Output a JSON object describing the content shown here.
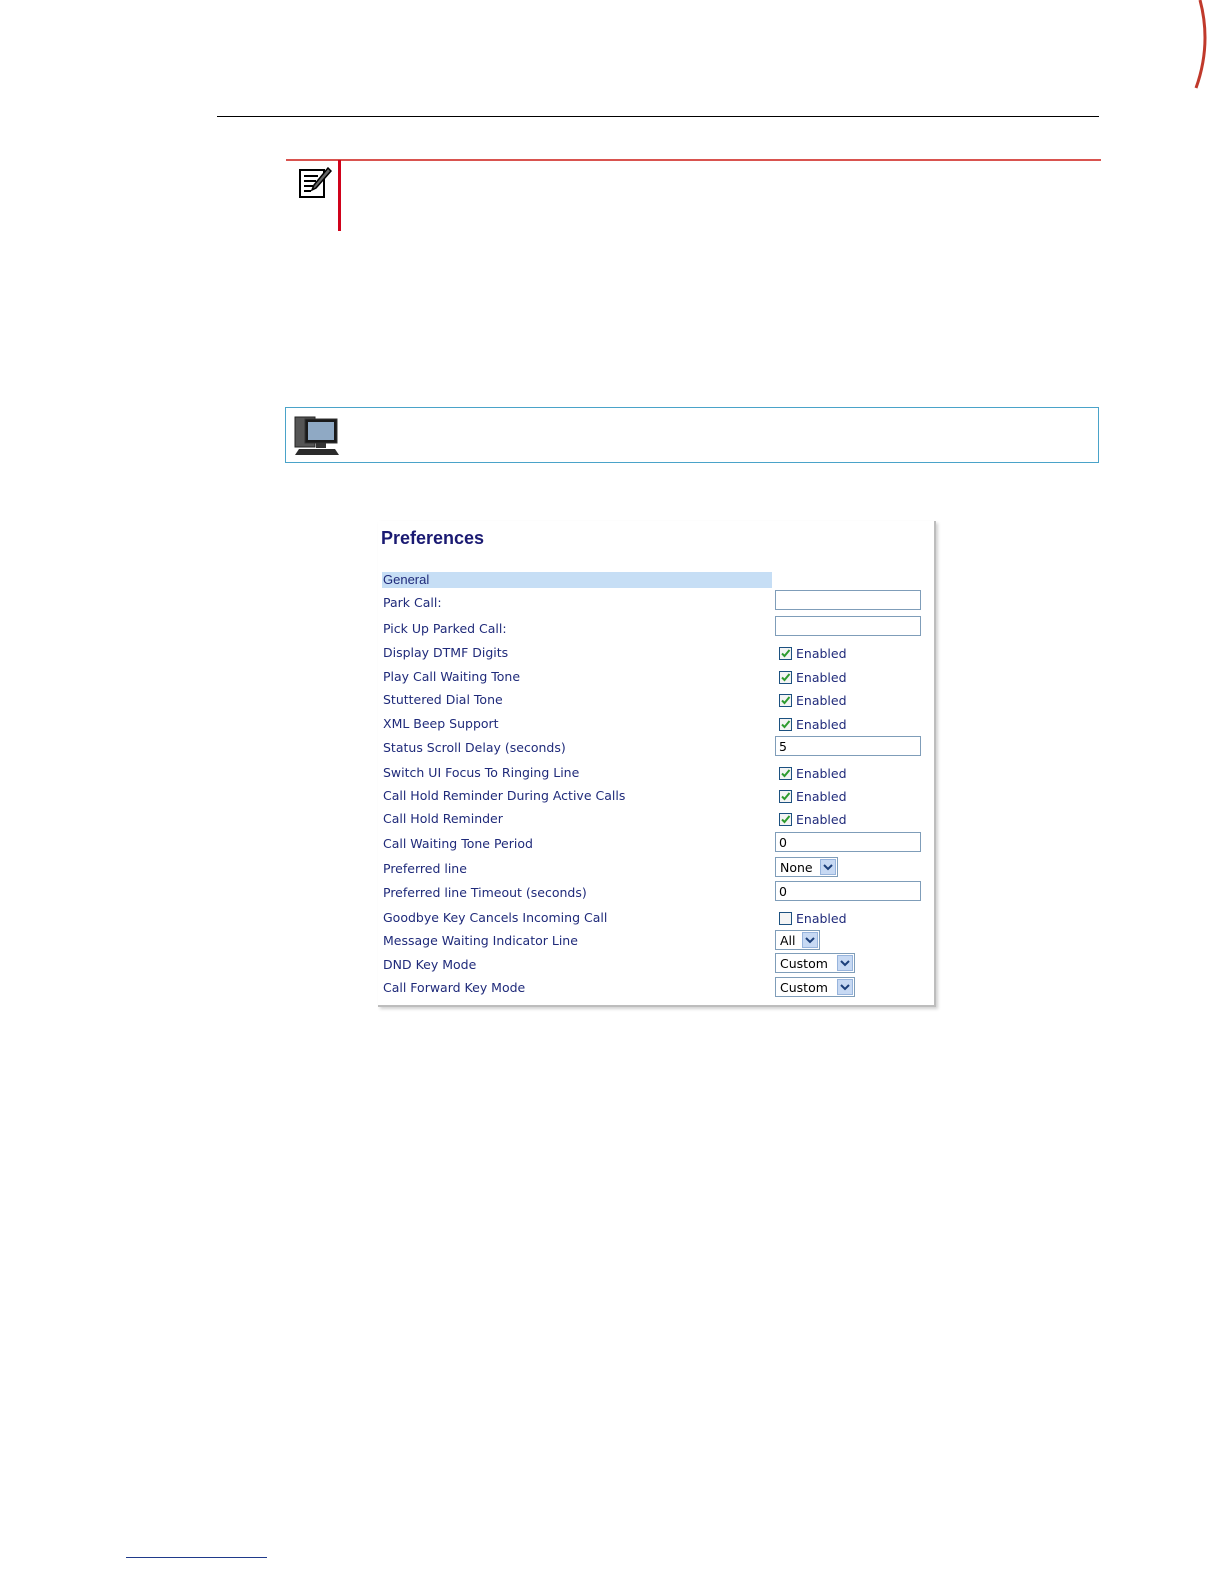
{
  "preferences": {
    "title": "Preferences",
    "section": "General",
    "rows": [
      {
        "label": "Park Call:",
        "control": "text",
        "value": ""
      },
      {
        "label": "Pick Up Parked Call:",
        "control": "text",
        "value": ""
      },
      {
        "label": "Display DTMF Digits",
        "control": "checkbox",
        "checked": true,
        "option": "Enabled"
      },
      {
        "label": "Play Call Waiting Tone",
        "control": "checkbox",
        "checked": true,
        "option": "Enabled"
      },
      {
        "label": "Stuttered Dial Tone",
        "control": "checkbox",
        "checked": true,
        "option": "Enabled"
      },
      {
        "label": "XML Beep Support",
        "control": "checkbox",
        "checked": true,
        "option": "Enabled"
      },
      {
        "label": "Status Scroll Delay (seconds)",
        "control": "text",
        "value": "5"
      },
      {
        "label": "Switch UI Focus To Ringing Line",
        "control": "checkbox",
        "checked": true,
        "option": "Enabled"
      },
      {
        "label": "Call Hold Reminder During Active Calls",
        "control": "checkbox",
        "checked": true,
        "option": "Enabled"
      },
      {
        "label": "Call Hold Reminder",
        "control": "checkbox",
        "checked": true,
        "option": "Enabled"
      },
      {
        "label": "Call Waiting Tone Period",
        "control": "text",
        "value": "0"
      },
      {
        "label": "Preferred line",
        "control": "select",
        "value": "None"
      },
      {
        "label": "Preferred line Timeout (seconds)",
        "control": "text",
        "value": "0"
      },
      {
        "label": "Goodbye Key Cancels Incoming Call",
        "control": "checkbox",
        "checked": false,
        "option": "Enabled"
      },
      {
        "label": "Message Waiting Indicator Line",
        "control": "select",
        "value": "All"
      },
      {
        "label": "DND Key Mode",
        "control": "select",
        "value": "Custom"
      },
      {
        "label": "Call Forward Key Mode",
        "control": "select",
        "value": "Custom"
      }
    ]
  },
  "colors": {
    "label": "#1f2a7a",
    "section_bg": "#c6def5",
    "note_accent": "#d0021b",
    "web_box_border": "#4aa3c9",
    "checkmark": "#2e9b2e"
  },
  "icons": {
    "note": "notepad-pencil-icon",
    "web": "computer-monitor-icon",
    "dropdown": "chevron-down-icon"
  }
}
